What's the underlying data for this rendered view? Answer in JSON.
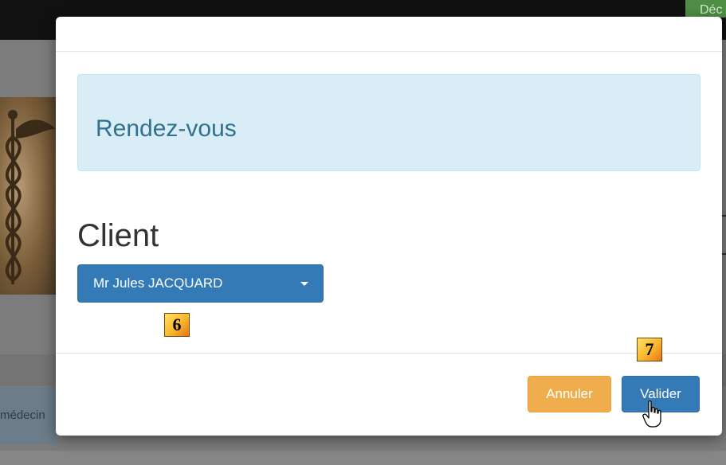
{
  "background": {
    "top_button_label": "Déc",
    "info_cell_text": "médecin"
  },
  "modal": {
    "alert_title": "Rendez-vous",
    "client_heading": "Client",
    "client_select": {
      "selected": "Mr Jules JACQUARD"
    },
    "footer": {
      "cancel_label": "Annuler",
      "confirm_label": "Valider"
    }
  },
  "markers": {
    "step_6": "6",
    "step_7": "7"
  },
  "colors": {
    "primary": "#337ab7",
    "warning": "#f0ad4e",
    "info_bg": "#d9edf7",
    "info_text": "#31708f"
  }
}
